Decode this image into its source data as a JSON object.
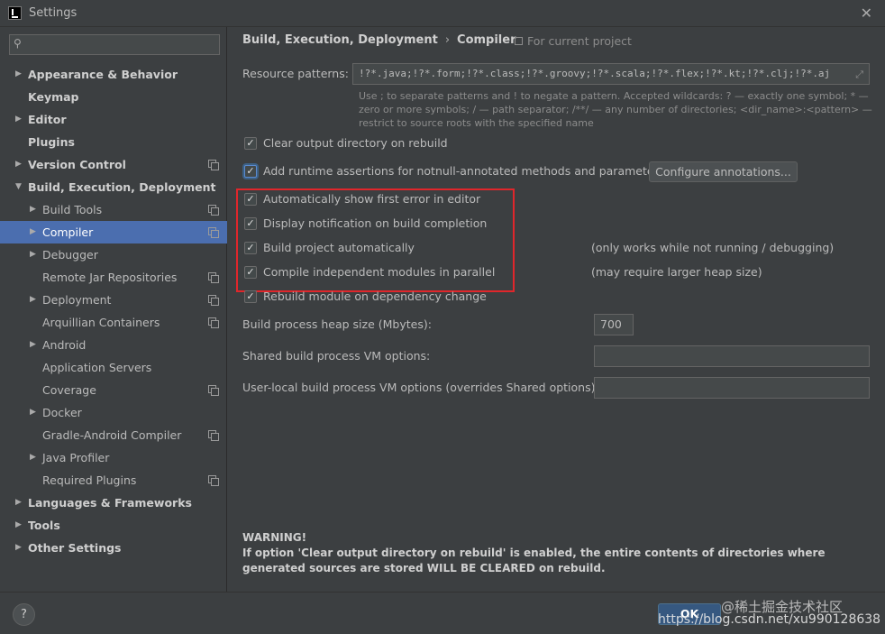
{
  "window": {
    "title": "Settings"
  },
  "search": {
    "placeholder": ""
  },
  "sidebar": {
    "items": [
      {
        "label": "Appearance & Behavior",
        "level": 0,
        "arrow": "▶",
        "bold": true,
        "copy": false,
        "selected": false
      },
      {
        "label": "Keymap",
        "level": 0,
        "arrow": "",
        "bold": true,
        "copy": false,
        "selected": false
      },
      {
        "label": "Editor",
        "level": 0,
        "arrow": "▶",
        "bold": true,
        "copy": false,
        "selected": false
      },
      {
        "label": "Plugins",
        "level": 0,
        "arrow": "",
        "bold": true,
        "copy": false,
        "selected": false
      },
      {
        "label": "Version Control",
        "level": 0,
        "arrow": "▶",
        "bold": true,
        "copy": true,
        "selected": false
      },
      {
        "label": "Build, Execution, Deployment",
        "level": 0,
        "arrow": "▼",
        "bold": true,
        "copy": false,
        "selected": false
      },
      {
        "label": "Build Tools",
        "level": 1,
        "arrow": "▶",
        "bold": false,
        "copy": true,
        "selected": false
      },
      {
        "label": "Compiler",
        "level": 1,
        "arrow": "▶",
        "bold": false,
        "copy": true,
        "selected": true
      },
      {
        "label": "Debugger",
        "level": 1,
        "arrow": "▶",
        "bold": false,
        "copy": false,
        "selected": false
      },
      {
        "label": "Remote Jar Repositories",
        "level": 1,
        "arrow": "",
        "bold": false,
        "copy": true,
        "selected": false
      },
      {
        "label": "Deployment",
        "level": 1,
        "arrow": "▶",
        "bold": false,
        "copy": true,
        "selected": false
      },
      {
        "label": "Arquillian Containers",
        "level": 1,
        "arrow": "",
        "bold": false,
        "copy": true,
        "selected": false
      },
      {
        "label": "Android",
        "level": 1,
        "arrow": "▶",
        "bold": false,
        "copy": false,
        "selected": false
      },
      {
        "label": "Application Servers",
        "level": 1,
        "arrow": "",
        "bold": false,
        "copy": false,
        "selected": false
      },
      {
        "label": "Coverage",
        "level": 1,
        "arrow": "",
        "bold": false,
        "copy": true,
        "selected": false
      },
      {
        "label": "Docker",
        "level": 1,
        "arrow": "▶",
        "bold": false,
        "copy": false,
        "selected": false
      },
      {
        "label": "Gradle-Android Compiler",
        "level": 1,
        "arrow": "",
        "bold": false,
        "copy": true,
        "selected": false
      },
      {
        "label": "Java Profiler",
        "level": 1,
        "arrow": "▶",
        "bold": false,
        "copy": false,
        "selected": false
      },
      {
        "label": "Required Plugins",
        "level": 1,
        "arrow": "",
        "bold": false,
        "copy": true,
        "selected": false
      },
      {
        "label": "Languages & Frameworks",
        "level": 0,
        "arrow": "▶",
        "bold": true,
        "copy": false,
        "selected": false
      },
      {
        "label": "Tools",
        "level": 0,
        "arrow": "▶",
        "bold": true,
        "copy": false,
        "selected": false
      },
      {
        "label": "Other Settings",
        "level": 0,
        "arrow": "▶",
        "bold": true,
        "copy": false,
        "selected": false
      }
    ]
  },
  "main": {
    "breadcrumb": {
      "parent": "Build, Execution, Deployment",
      "separator": "›",
      "current": "Compiler"
    },
    "scope_label": "For current project",
    "resource_patterns": {
      "label": "Resource patterns:",
      "value": "!?*.java;!?*.form;!?*.class;!?*.groovy;!?*.scala;!?*.flex;!?*.kt;!?*.clj;!?*.aj",
      "hint": "Use ; to separate patterns and ! to negate a pattern. Accepted wildcards: ? — exactly one symbol; * — zero or more symbols; / — path separator; /**/ — any number of directories; <dir_name>:<pattern> — restrict to source roots with the specified name"
    },
    "checkboxes": {
      "clear_output": {
        "label": "Clear output directory on rebuild",
        "checked": true
      },
      "runtime_assertions": {
        "label": "Add runtime assertions for notnull-annotated methods and parameters",
        "checked": true
      },
      "show_first_error": {
        "label": "Automatically show first error in editor",
        "checked": true
      },
      "build_notification": {
        "label": "Display notification on build completion",
        "checked": true
      },
      "build_auto": {
        "label": "Build project automatically",
        "checked": true
      },
      "parallel": {
        "label": "Compile independent modules in parallel",
        "checked": true
      },
      "rebuild_on_change": {
        "label": "Rebuild module on dependency change",
        "checked": true
      }
    },
    "configure_annotations_label": "Configure annotations...",
    "notes": {
      "build_auto": "(only works while not running / debugging)",
      "parallel": "(may require larger heap size)"
    },
    "heap": {
      "label": "Build process heap size (Mbytes):",
      "value": "700"
    },
    "shared_vm": {
      "label": "Shared build process VM options:",
      "value": ""
    },
    "user_vm": {
      "label": "User-local build process VM options (overrides Shared options):",
      "value": ""
    },
    "warning": {
      "title": "WARNING!",
      "text": "If option 'Clear output directory on rebuild' is enabled, the entire contents of directories where generated sources are stored WILL BE CLEARED on rebuild."
    }
  },
  "footer": {
    "help_label": "?",
    "ok_label": "OK",
    "watermark_top": "@稀土掘金技术社区",
    "watermark_url": "https://blog.csdn.net/xu990128638"
  },
  "colors": {
    "accent": "#4b6eaf",
    "highlight_box": "#e0262b",
    "background": "#3c3f41"
  }
}
